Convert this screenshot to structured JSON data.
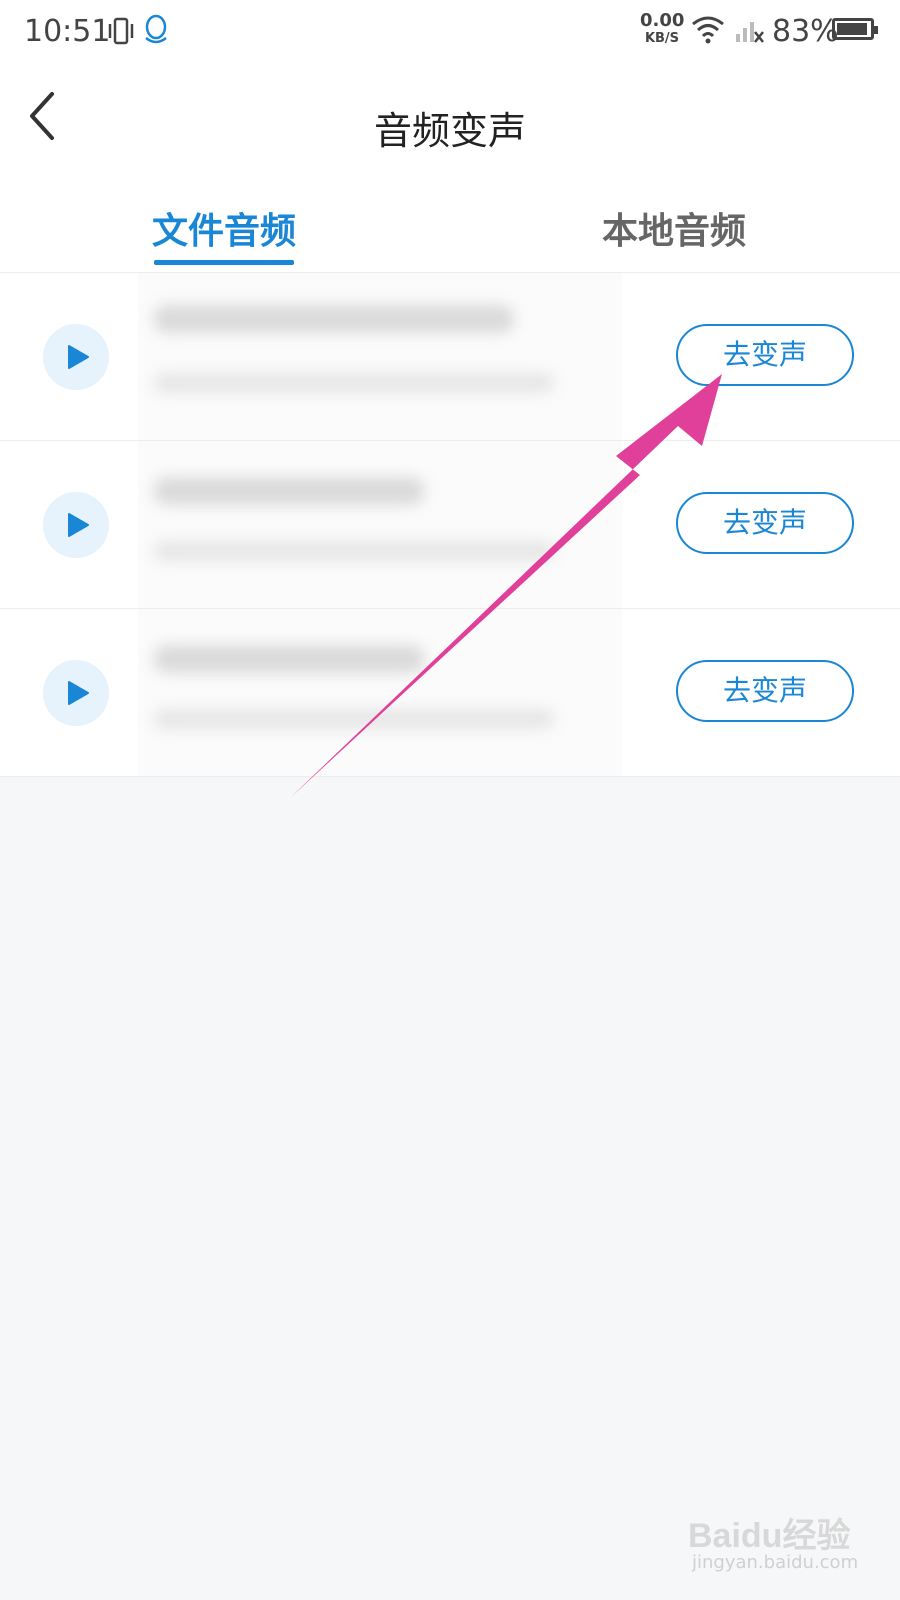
{
  "status_bar": {
    "time": "10:51",
    "net_speed_value": "0.00",
    "net_speed_unit": "KB/S",
    "battery_text": "83%",
    "icons": [
      "vibrate-icon",
      "qq-icon",
      "wifi-icon",
      "signal-icon",
      "battery-icon"
    ]
  },
  "header": {
    "title": "音频变声",
    "back_icon": "chevron-left-icon"
  },
  "tabs": [
    {
      "label": "文件音频",
      "active": true
    },
    {
      "label": "本地音频",
      "active": false
    }
  ],
  "audio_list": [
    {
      "action_label": "去变声"
    },
    {
      "action_label": "去变声"
    },
    {
      "action_label": "去变声"
    }
  ],
  "watermark": {
    "brand": "Baidu经验",
    "url": "jingyan.baidu.com"
  },
  "colors": {
    "accent": "#1a86d6",
    "annotation_arrow": "#e0409a",
    "background": "#f6f7f9"
  }
}
